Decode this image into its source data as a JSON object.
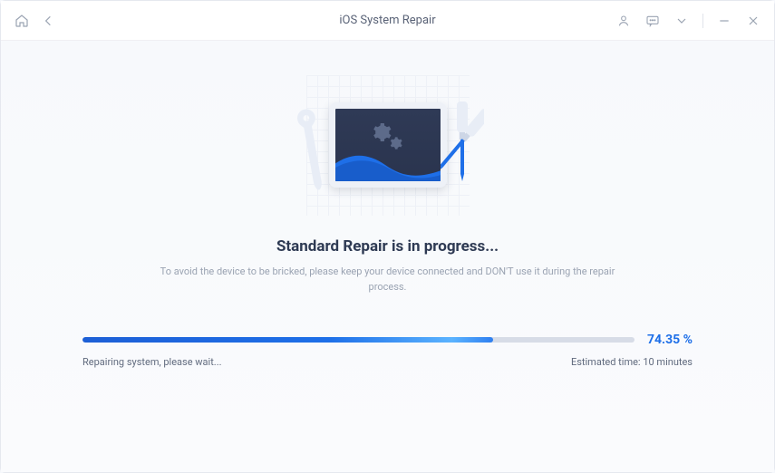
{
  "titlebar": {
    "title": "iOS System Repair"
  },
  "main": {
    "headline": "Standard Repair is in progress...",
    "subtext": "To avoid the device to be bricked, please keep your device connected and DON'T use it during the repair process."
  },
  "progress": {
    "percent_label": "74.35 %",
    "percent_value": 74.35,
    "status_text": "Repairing system, please wait...",
    "eta_text": "Estimated time: 10 minutes"
  }
}
